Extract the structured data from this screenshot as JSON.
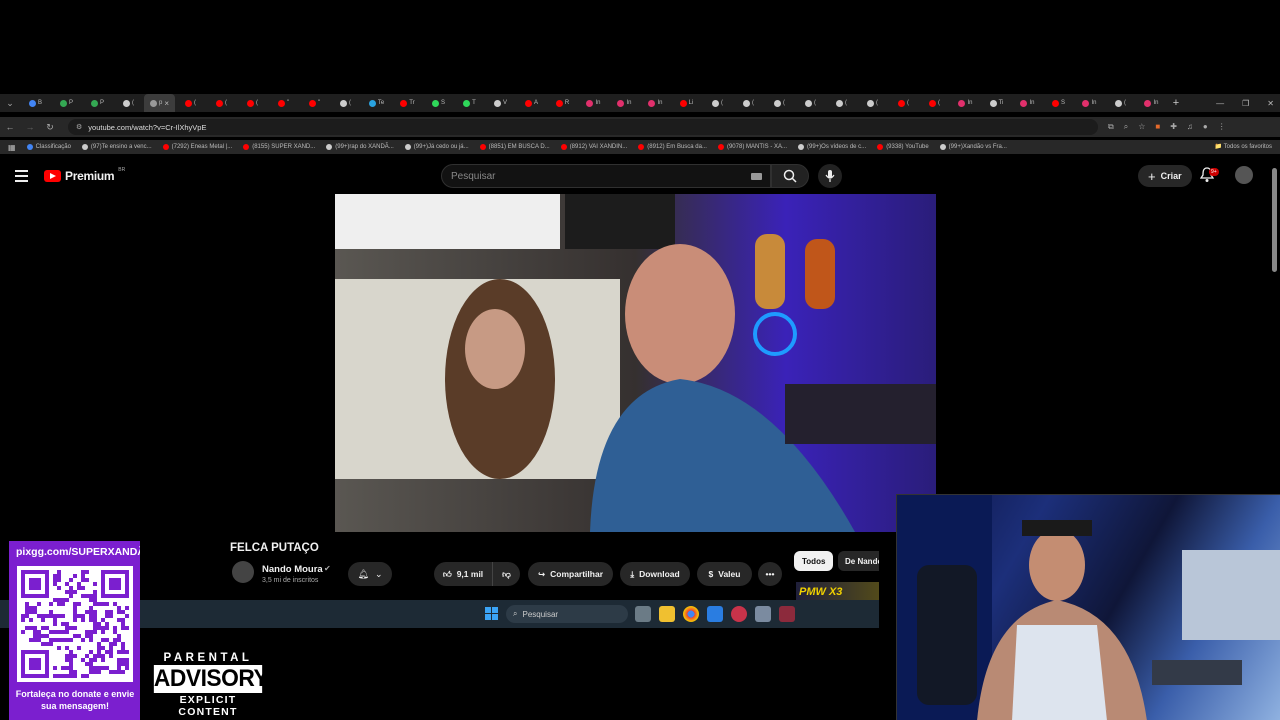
{
  "browser": {
    "tabs": [
      {
        "label": "B",
        "color": "#4285f4"
      },
      {
        "label": "P",
        "color": "#34a853"
      },
      {
        "label": "P",
        "color": "#34a853"
      },
      {
        "label": "(",
        "color": "#cccccc"
      },
      {
        "label": "p",
        "color": "#999999",
        "active": true
      },
      {
        "label": "(",
        "color": "#ff0000"
      },
      {
        "label": "(",
        "color": "#ff0000"
      },
      {
        "label": "(",
        "color": "#ff0000"
      },
      {
        "label": "\"",
        "color": "#ff0000"
      },
      {
        "label": "\"",
        "color": "#ff0000"
      },
      {
        "label": "(",
        "color": "#cccccc"
      },
      {
        "label": "Te",
        "color": "#2aa3e0"
      },
      {
        "label": "Tr",
        "color": "#ff0000"
      },
      {
        "label": "S",
        "color": "#2fd85a"
      },
      {
        "label": "T",
        "color": "#2fd85a"
      },
      {
        "label": "V",
        "color": "#cccccc"
      },
      {
        "label": "A",
        "color": "#ff0000"
      },
      {
        "label": "R",
        "color": "#ff0000"
      },
      {
        "label": "In",
        "color": "#e1306c"
      },
      {
        "label": "In",
        "color": "#e1306c"
      },
      {
        "label": "In",
        "color": "#e1306c"
      },
      {
        "label": "Li",
        "color": "#ff0000"
      },
      {
        "label": "(",
        "color": "#cccccc"
      },
      {
        "label": "(",
        "color": "#cccccc"
      },
      {
        "label": "(",
        "color": "#cccccc"
      },
      {
        "label": "(",
        "color": "#cccccc"
      },
      {
        "label": "(",
        "color": "#cccccc"
      },
      {
        "label": "(",
        "color": "#cccccc"
      },
      {
        "label": "(",
        "color": "#ff0000"
      },
      {
        "label": "(",
        "color": "#ff0000"
      },
      {
        "label": "In",
        "color": "#e1306c"
      },
      {
        "label": "Ti",
        "color": "#cccccc"
      },
      {
        "label": "In",
        "color": "#e1306c"
      },
      {
        "label": "S",
        "color": "#ff0000"
      },
      {
        "label": "In",
        "color": "#e1306c"
      },
      {
        "label": "(",
        "color": "#cccccc"
      },
      {
        "label": "In",
        "color": "#e1306c"
      }
    ],
    "new_tab": "+",
    "url": "youtube.com/watch?v=Cr-IlXhyVpE",
    "bookmarks": [
      {
        "label": "Classificação",
        "color": "#4285f4"
      },
      {
        "label": "(97)Te ensino a venc...",
        "color": "#cccccc"
      },
      {
        "label": "(7292) Eneas Metal |...",
        "color": "#ff0000"
      },
      {
        "label": "(8155) SUPER XAND...",
        "color": "#ff0000"
      },
      {
        "label": "(99+)rap do XANDÃ...",
        "color": "#cccccc"
      },
      {
        "label": "(99+)Já cedo ou já...",
        "color": "#cccccc"
      },
      {
        "label": "(8851) EM BUSCA D...",
        "color": "#ff0000"
      },
      {
        "label": "(8912) VAI XANDIN...",
        "color": "#ff0000"
      },
      {
        "label": "(8912) Em Busca da...",
        "color": "#ff0000"
      },
      {
        "label": "(9078) MANTIS - XA...",
        "color": "#ff0000"
      },
      {
        "label": "(99+)Os vídeos de c...",
        "color": "#cccccc"
      },
      {
        "label": "(9338) YouTube",
        "color": "#ff0000"
      },
      {
        "label": "(99+)Xandão vs Fra...",
        "color": "#cccccc"
      }
    ],
    "bookmarks_all": "Todos os favoritos"
  },
  "youtube": {
    "logo_text": "Premium",
    "country": "BR",
    "search_placeholder": "Pesquisar",
    "create_label": "Criar",
    "notif_count": "9+",
    "video": {
      "title": "FELCA PUTAÇO",
      "channel": "Nando Moura",
      "subscribers": "3,5 mi de inscritos",
      "likes": "9,1 mil",
      "share_label": "Compartilhar",
      "download_label": "Download",
      "thanks_label": "Valeu"
    },
    "chips": [
      "Todos",
      "De Nando"
    ],
    "thumb_text": "PMW X3"
  },
  "taskbar": {
    "search_placeholder": "Pesquisar"
  },
  "overlay": {
    "donate_url": "pixgg.com/SUPERXANDÃO",
    "donate_message": "Fortaleça no donate e envie sua mensagem!",
    "advisory_top": "PARENTAL",
    "advisory_mid": "ADVISORY",
    "advisory_bot": "EXPLICIT CONTENT"
  },
  "colors": {
    "yt_red": "#ff0000",
    "donate_panel": "#7b1fcf",
    "taskbar": "#1d2a35"
  }
}
